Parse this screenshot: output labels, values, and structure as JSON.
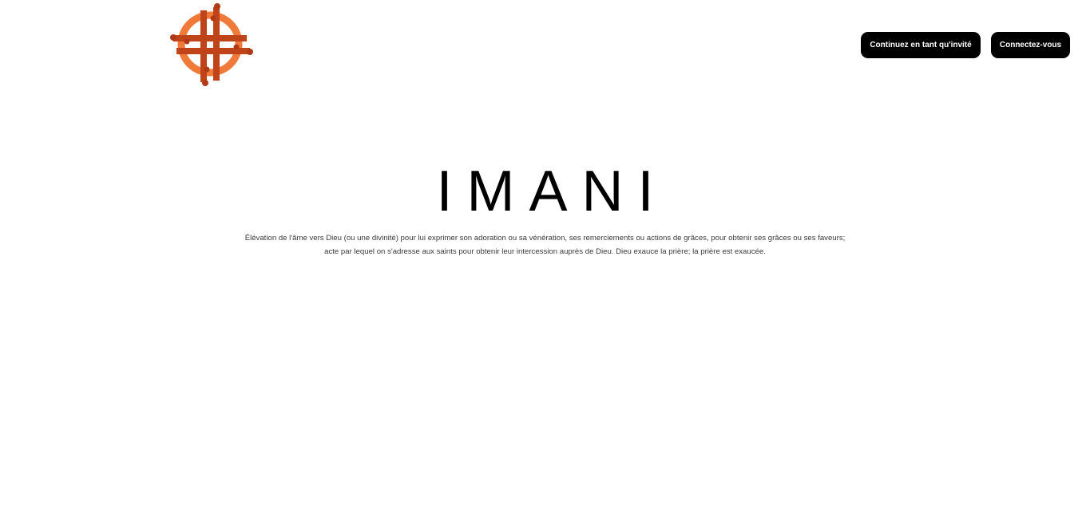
{
  "header": {
    "logo_icon": "imani-cross-logo-icon",
    "logo_colors": {
      "ring": "#f07a3a",
      "bars": "#c0441a",
      "dots": "#b03a16"
    },
    "guest_button_label": "Continuez en tant qu'invité",
    "login_button_label": "Connectez-vous"
  },
  "hero": {
    "title": "IMANI",
    "description": "Élévation de l'âme vers Dieu (ou une divinité) pour lui exprimer son adoration ou sa vénération, ses remerciements ou actions de grâces, pour obtenir ses grâces ou ses faveurs; acte par lequel on s'adresse aux saints pour obtenir leur intercession auprès de Dieu. Dieu exauce la prière; la prière est exaucée."
  }
}
